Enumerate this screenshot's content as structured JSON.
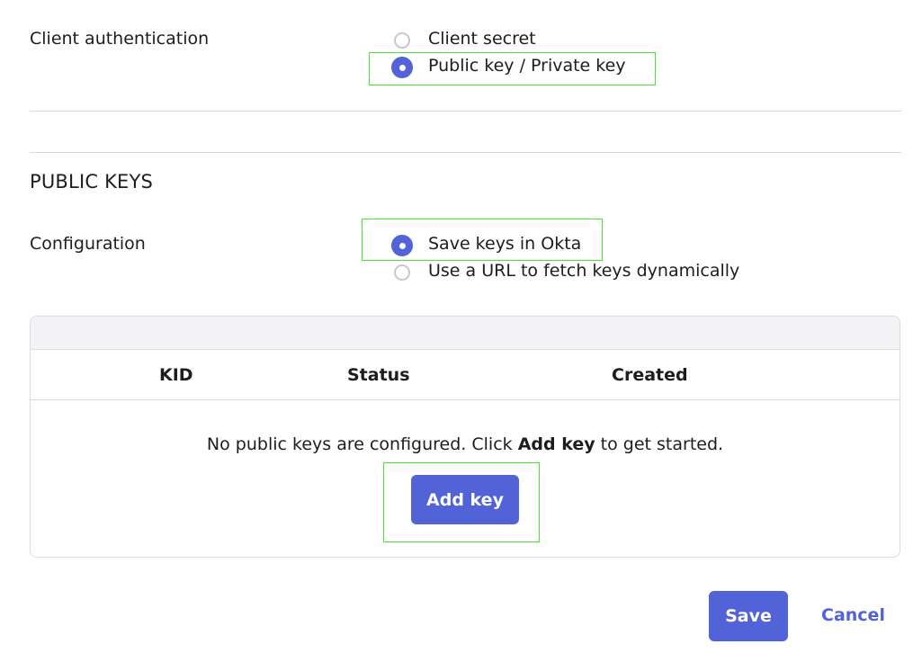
{
  "client_auth": {
    "label": "Client authentication",
    "options": [
      {
        "label": "Client secret",
        "selected": false
      },
      {
        "label": "Public key / Private key",
        "selected": true
      }
    ]
  },
  "public_keys": {
    "section_title": "PUBLIC KEYS",
    "configuration_label": "Configuration",
    "options": [
      {
        "label": "Save keys in Okta",
        "selected": true
      },
      {
        "label": "Use a URL to fetch keys dynamically",
        "selected": false
      }
    ],
    "table": {
      "columns": [
        "KID",
        "Status",
        "Created"
      ],
      "empty_prefix": "No public keys are configured. Click ",
      "empty_bold": "Add key",
      "empty_suffix": " to get started.",
      "add_key_label": "Add key"
    }
  },
  "footer": {
    "save_label": "Save",
    "cancel_label": "Cancel"
  },
  "colors": {
    "accent": "#5163d6",
    "highlight": "#45e62e"
  }
}
